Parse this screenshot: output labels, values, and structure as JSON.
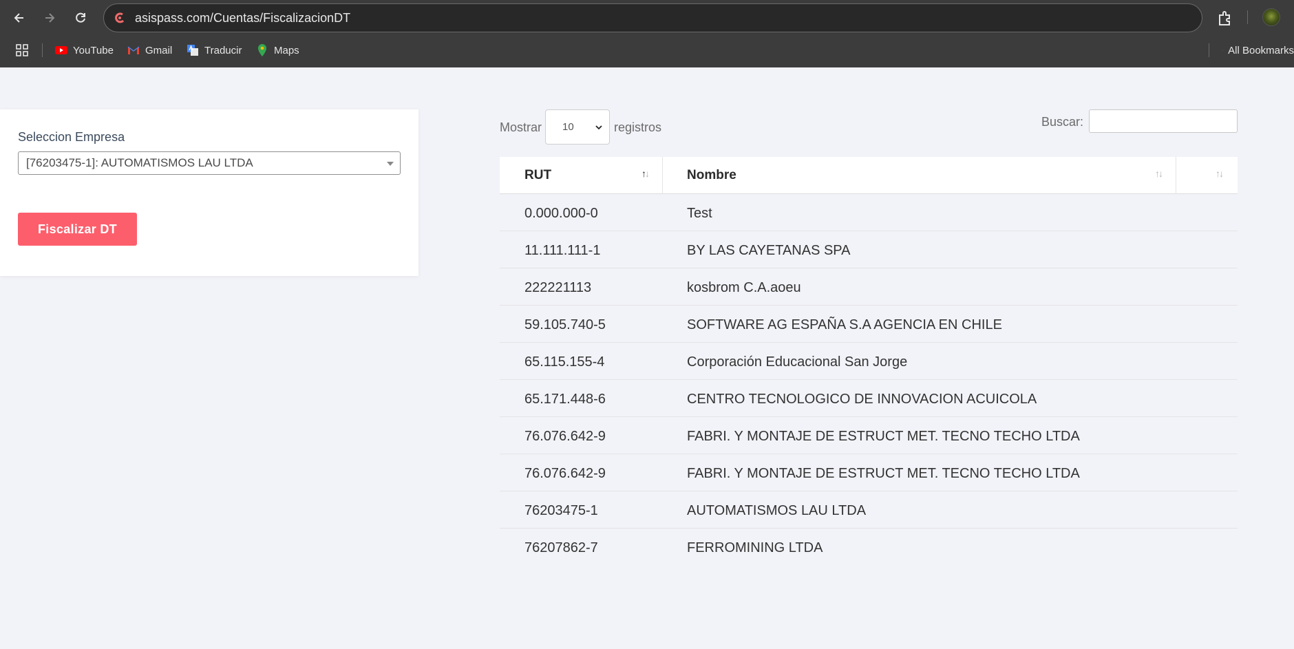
{
  "browser": {
    "url": "asispass.com/Cuentas/FiscalizacionDT",
    "bookmarks": [
      {
        "label": "YouTube",
        "icon": "youtube-icon"
      },
      {
        "label": "Gmail",
        "icon": "gmail-icon"
      },
      {
        "label": "Traducir",
        "icon": "translate-icon"
      },
      {
        "label": "Maps",
        "icon": "maps-icon"
      }
    ],
    "all_bookmarks": "All Bookmarks"
  },
  "form": {
    "label": "Seleccion Empresa",
    "selected_company": "[76203475-1]: AUTOMATISMOS LAU LTDA",
    "submit_label": "Fiscalizar DT",
    "submit_color": "#fd5e6c"
  },
  "table_controls": {
    "show_label": "Mostrar",
    "page_length": "10",
    "records_label": "registros",
    "search_label": "Buscar:",
    "search_value": ""
  },
  "table": {
    "columns": [
      "RUT",
      "Nombre",
      ""
    ],
    "rows": [
      {
        "rut": "0.000.000-0",
        "nombre": "Test"
      },
      {
        "rut": "11.111.111-1",
        "nombre": "BY LAS CAYETANAS SPA"
      },
      {
        "rut": "222221113",
        "nombre": "kosbrom C.A.aoeu"
      },
      {
        "rut": "59.105.740-5",
        "nombre": "SOFTWARE AG ESPAÑA S.A AGENCIA EN CHILE"
      },
      {
        "rut": "65.115.155-4",
        "nombre": "Corporación Educacional San Jorge"
      },
      {
        "rut": "65.171.448-6",
        "nombre": "CENTRO TECNOLOGICO DE INNOVACION ACUICOLA"
      },
      {
        "rut": "76.076.642-9",
        "nombre": "FABRI. Y MONTAJE DE ESTRUCT MET. TECNO TECHO LTDA"
      },
      {
        "rut": "76.076.642-9",
        "nombre": "FABRI. Y MONTAJE DE ESTRUCT MET. TECNO TECHO LTDA"
      },
      {
        "rut": "76203475-1",
        "nombre": "AUTOMATISMOS LAU LTDA"
      },
      {
        "rut": "76207862-7",
        "nombre": "FERROMINING LTDA"
      }
    ]
  }
}
